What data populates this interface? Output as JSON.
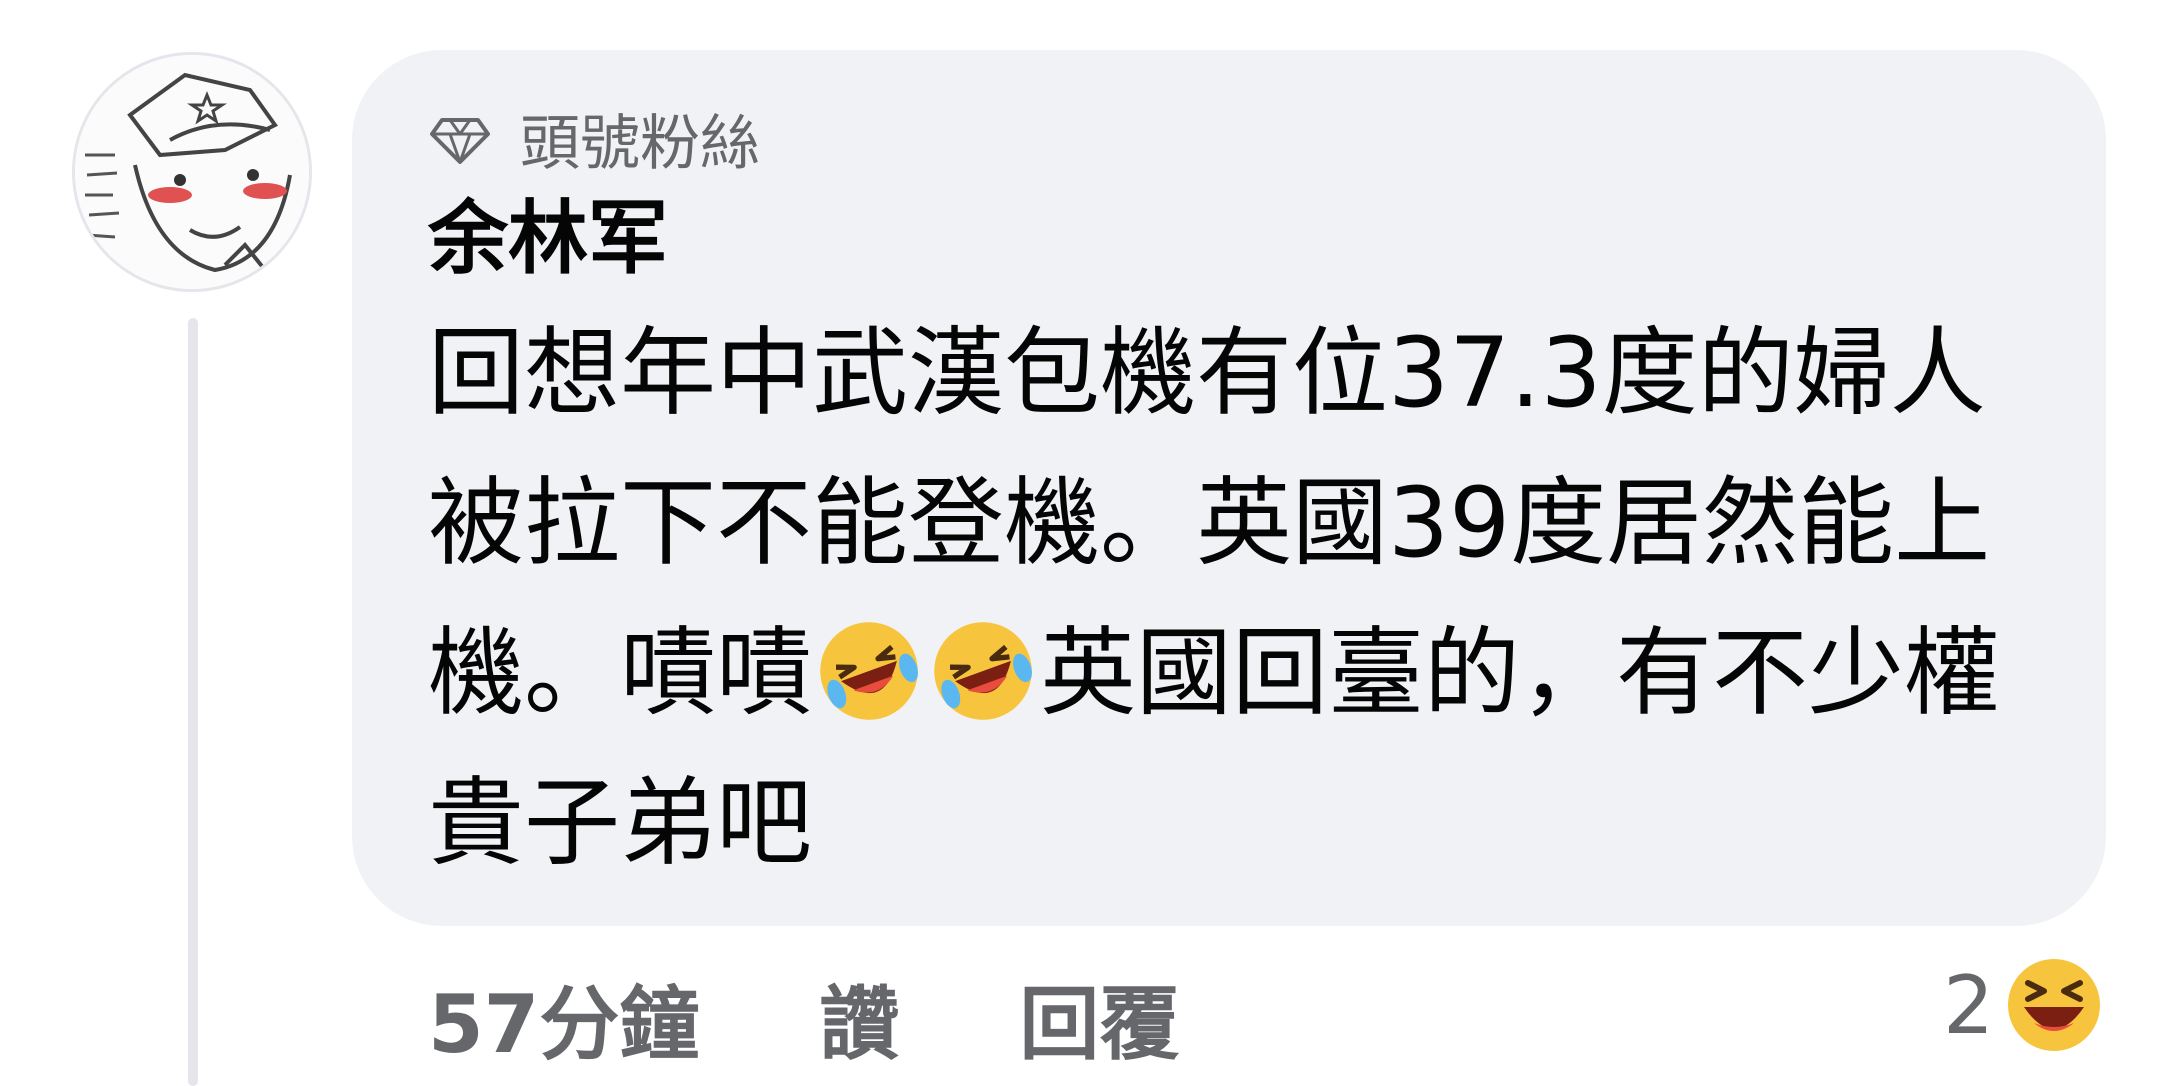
{
  "comment": {
    "badge_label": "頭號粉絲",
    "author": "余林军",
    "body": {
      "part1": "回想年中武漢包機有位37.3度的婦人被拉下不能登機。英國39度居然能上機。嘖嘖",
      "part2": "英國回臺的，有不少權貴子弟吧"
    },
    "inline_emojis": [
      "rolling-on-floor-laughing",
      "rolling-on-floor-laughing"
    ],
    "timestamp": "57分鐘",
    "like_label": "讚",
    "reply_label": "回覆",
    "reaction_count": "2",
    "reaction_emoji": "laughing-face"
  },
  "colors": {
    "bubble_bg": "#f0f2f5",
    "secondary_text": "#65676b",
    "primary_text": "#050505",
    "thread_line": "#e4e6eb"
  }
}
